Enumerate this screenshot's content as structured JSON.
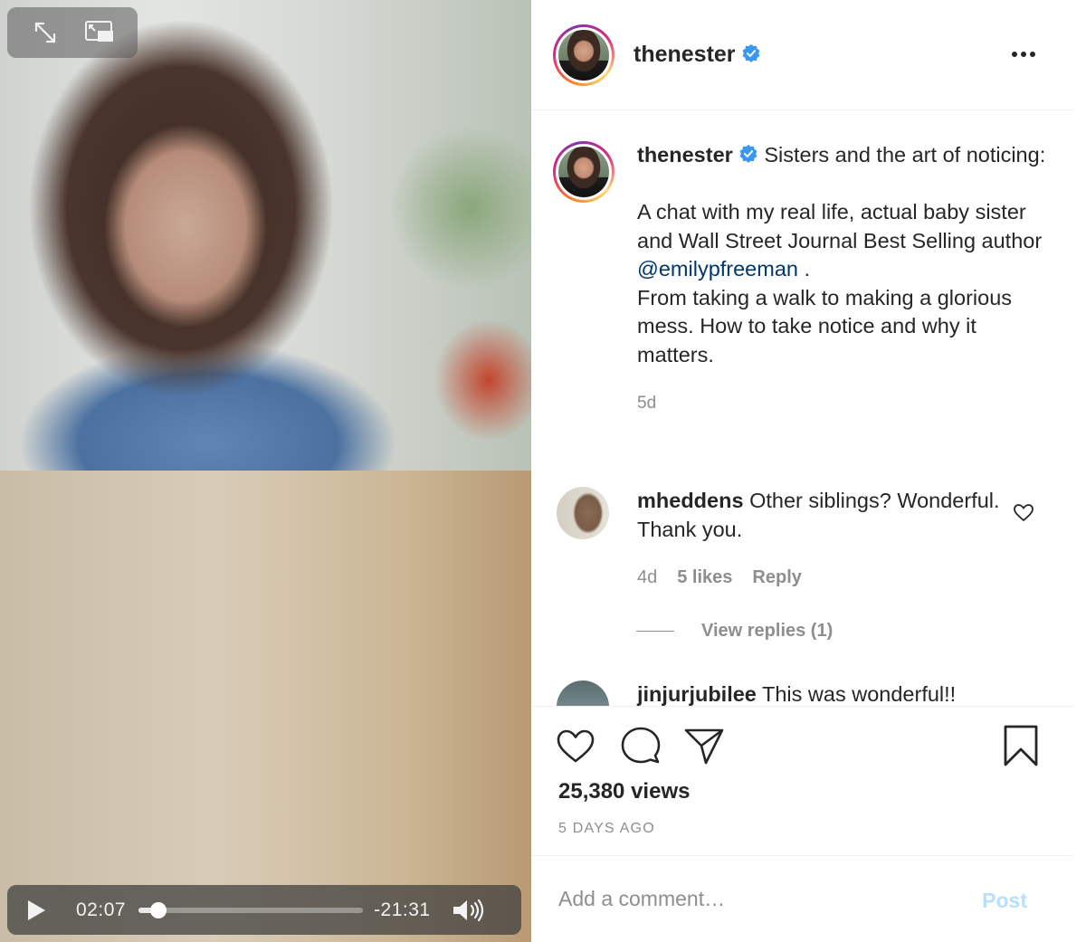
{
  "video": {
    "current_time": "02:07",
    "remaining_time": "-21:31",
    "progress": 0.09
  },
  "post": {
    "username": "thenester",
    "caption_title": "Sisters and the art of noticing:",
    "caption_line2_pre": "A chat with my real life, actual baby sister and Wall Street Journal Best Selling author ",
    "caption_mention": "@emilypfreeman",
    "caption_line2_post": " .\nFrom taking a walk to making a glorious mess. How to take notice and why it matters.",
    "caption_time": "5d",
    "views": "25,380 views",
    "date": "5 DAYS AGO"
  },
  "comments": [
    {
      "username": "mheddens",
      "text": "Other siblings? Wonderful. Thank you.",
      "time": "4d",
      "likes": "5 likes",
      "reply_label": "Reply",
      "view_replies": "View replies (1)"
    },
    {
      "username": "jinjurjubilee",
      "text": "This was wonderful!!"
    }
  ],
  "add_comment": {
    "placeholder": "Add a comment…",
    "post_label": "Post"
  },
  "colors": {
    "link": "#00376b",
    "verified": "#3897f0",
    "post_disabled": "#b9dffc"
  },
  "icons": [
    "expand-icon",
    "picture-in-picture-icon",
    "play-icon",
    "volume-icon",
    "verified-badge-icon",
    "more-icon",
    "heart-icon",
    "comment-icon",
    "share-icon",
    "bookmark-icon"
  ]
}
